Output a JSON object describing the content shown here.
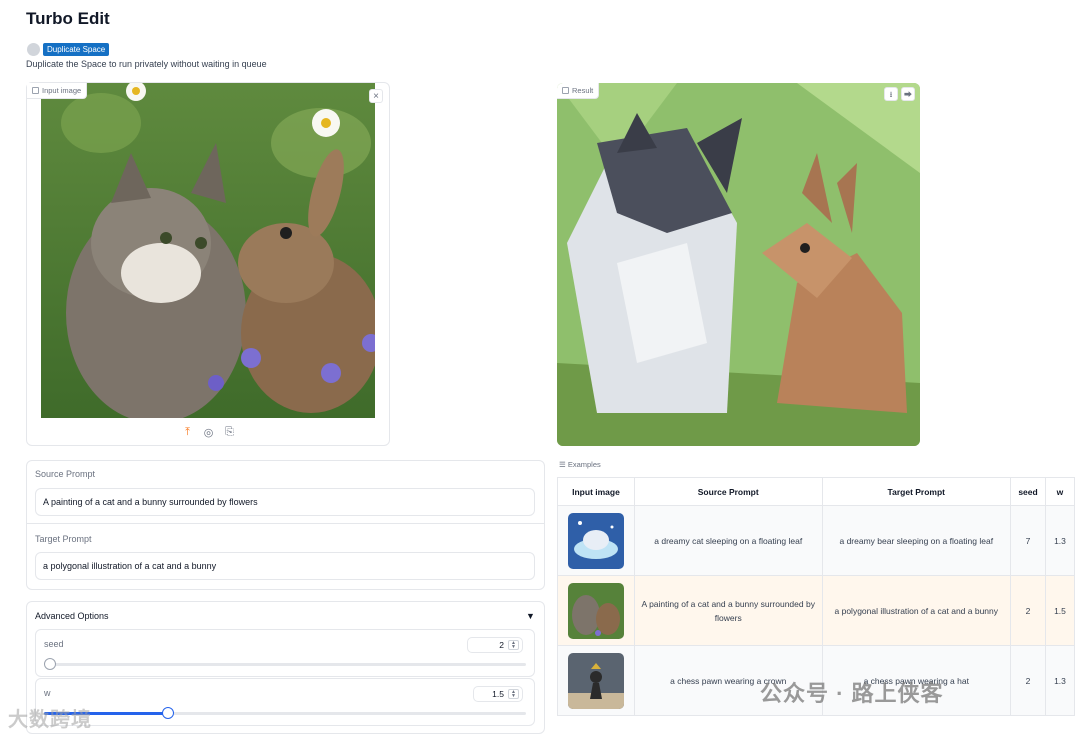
{
  "app": {
    "title": "Turbo Edit"
  },
  "duplicate": {
    "button_label": "Duplicate Space",
    "description": "Duplicate the Space to run privately without waiting in queue"
  },
  "input_image": {
    "label": "Input image",
    "close_glyph": "×",
    "tools": [
      "upload-icon",
      "webcam-icon",
      "clipboard-icon"
    ]
  },
  "result": {
    "label": "Result",
    "buttons": [
      "download-icon",
      "share-icon"
    ]
  },
  "source_prompt": {
    "label": "Source Prompt",
    "value": "A painting of a cat and a bunny surrounded by flowers"
  },
  "target_prompt": {
    "label": "Target Prompt",
    "value": "a polygonal illustration of a cat and a bunny"
  },
  "advanced": {
    "label": "Advanced Options",
    "caret": "▼",
    "seed": {
      "label": "seed",
      "value": "2",
      "slider_fraction": 0.0
    },
    "w": {
      "label": "w",
      "value": "1.5",
      "slider_fraction": 0.25
    }
  },
  "examples": {
    "label": "Examples",
    "headers": [
      "Input image",
      "Source Prompt",
      "Target Prompt",
      "seed",
      "w"
    ],
    "rows": [
      {
        "source": "a dreamy cat sleeping on a floating leaf",
        "target": "a dreamy bear sleeping on a floating leaf",
        "seed": "7",
        "w": "1.3"
      },
      {
        "source": "A painting of a cat and a bunny surrounded by flowers",
        "target": "a polygonal illustration of a cat and a bunny",
        "seed": "2",
        "w": "1.5"
      },
      {
        "source": "a chess pawn wearing a crown",
        "target": "a chess pawn wearing a hat",
        "seed": "2",
        "w": "1.3"
      }
    ]
  },
  "watermarks": {
    "left": "大数跨境",
    "right": "公众号 · 路上侠客"
  },
  "colors": {
    "accent": "#2563eb",
    "duplicate_bg": "#1570c4",
    "upload_icon": "#f97316"
  }
}
